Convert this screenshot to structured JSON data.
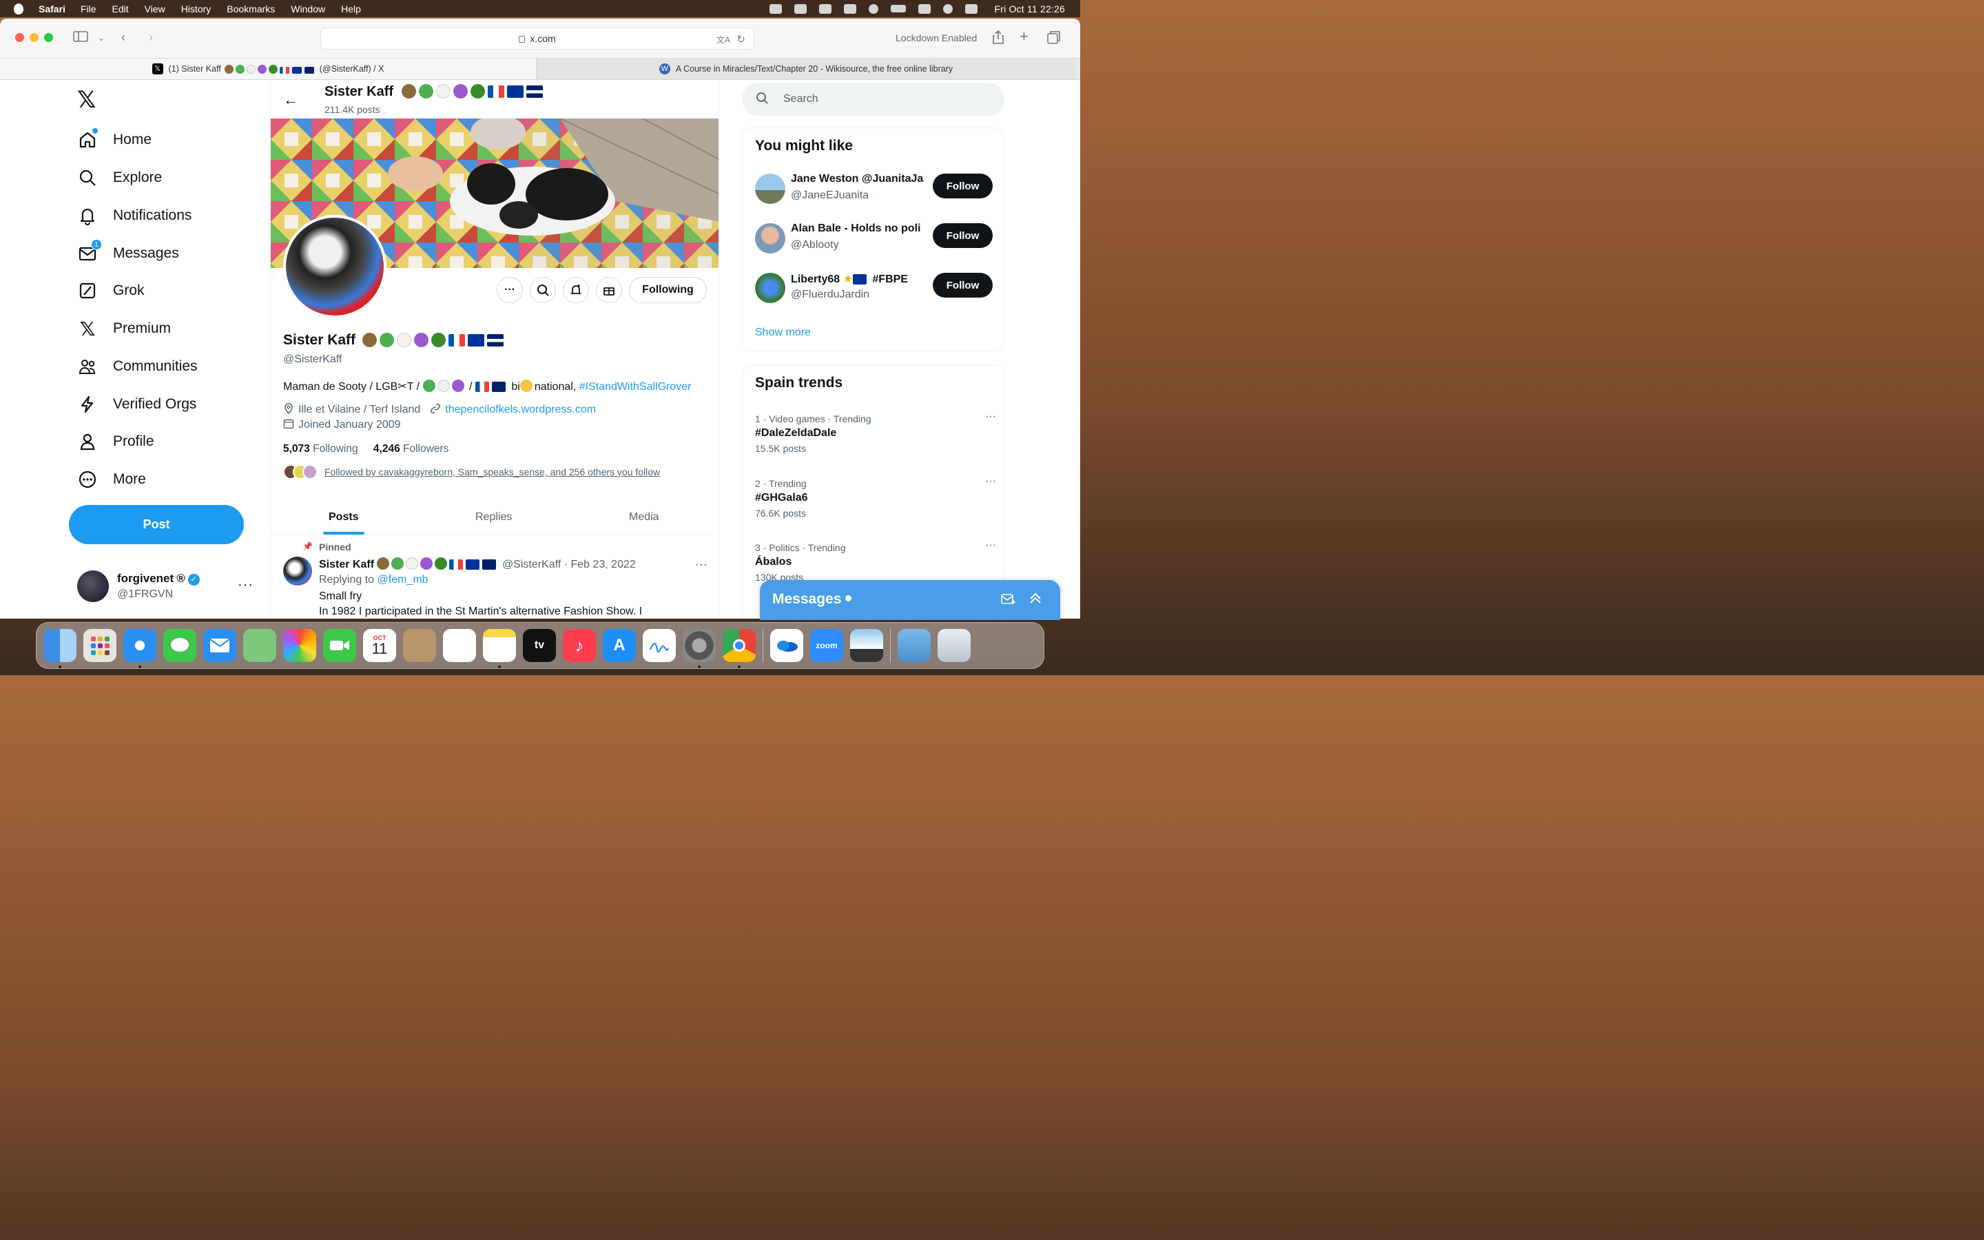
{
  "menubar": {
    "app": "Safari",
    "items": [
      "File",
      "Edit",
      "View",
      "History",
      "Bookmarks",
      "Window",
      "Help"
    ],
    "clock": "Fri Oct 11  22:26"
  },
  "browser": {
    "url": "x.com",
    "lockdown": "Lockdown Enabled",
    "tabs": [
      {
        "title": "(1) Sister Kaff",
        "suffix": "(@SisterKaff) / X"
      },
      {
        "title": "A Course in Miracles/Text/Chapter 20 - Wikisource, the free online library"
      }
    ]
  },
  "nav": {
    "items": [
      {
        "label": "Home",
        "icon": "home-icon"
      },
      {
        "label": "Explore",
        "icon": "search-icon"
      },
      {
        "label": "Notifications",
        "icon": "bell-icon"
      },
      {
        "label": "Messages",
        "icon": "mail-icon",
        "badge": "1"
      },
      {
        "label": "Grok",
        "icon": "grok-icon"
      },
      {
        "label": "Premium",
        "icon": "x-logo-icon"
      },
      {
        "label": "Communities",
        "icon": "people-icon"
      },
      {
        "label": "Verified Orgs",
        "icon": "lightning-icon"
      },
      {
        "label": "Profile",
        "icon": "person-icon"
      },
      {
        "label": "More",
        "icon": "more-circle-icon"
      }
    ],
    "post_label": "Post",
    "account": {
      "name": "forgivenet",
      "symbol": "®",
      "handle": "@1FRGVN"
    }
  },
  "profile": {
    "name": "Sister Kaff",
    "posts_count": "211.4K posts",
    "handle": "@SisterKaff",
    "following_label": "Following",
    "bio_text": "Maman de Sooty / LGB",
    "bio_t": "T /",
    "bio_mid": "/",
    "bio_bi": "bi",
    "bio_national": "national,",
    "bio_hashtag": "#IStandWithSallGrover",
    "location": "Ille et Vilaine / Terf Island",
    "website": "thepencilofkels.wordpress.com",
    "joined": "Joined January 2009",
    "following_count": "5,073",
    "following_text": "Following",
    "followers_count": "4,246",
    "followers_text": "Followers",
    "followed_by": "Followed by cavakaggyreborn, Sam_speaks_sense, and 256 others you follow",
    "tabs": [
      "Posts",
      "Replies",
      "Media"
    ]
  },
  "pinned_tweet": {
    "pinned_label": "Pinned",
    "name": "Sister Kaff",
    "handle_date": "@SisterKaff · Feb 23, 2022",
    "replying_prefix": "Replying to",
    "replying_to": "@fem_mb",
    "line1": "Small fry",
    "line2": "In 1982 I participated in the St Martin's alternative Fashion Show. I"
  },
  "sidebar": {
    "search_placeholder": "Search",
    "wtf_title": "You might like",
    "suggestions": [
      {
        "name": "Jane Weston @JuanitaJa",
        "handle": "@JaneEJuanita",
        "button": "Follow"
      },
      {
        "name": "Alan Bale - Holds no poli",
        "handle": "@Ablooty",
        "button": "Follow"
      },
      {
        "name": "Liberty68",
        "name_tail": "#FBPE",
        "handle": "@FluerduJardin",
        "button": "Follow"
      }
    ],
    "show_more": "Show more",
    "trends_title": "Spain trends",
    "trends": [
      {
        "meta": "1 · Video games · Trending",
        "name": "#DaleZeldaDale",
        "posts": "15.5K posts"
      },
      {
        "meta": "2 · Trending",
        "name": "#GHGala6",
        "posts": "76.6K posts"
      },
      {
        "meta": "3 · Politics · Trending",
        "name": "Ábalos",
        "posts": "130K posts"
      }
    ]
  },
  "messages_drawer": {
    "title": "Messages"
  },
  "dock": {
    "calendar_month": "OCT",
    "calendar_day": "11",
    "appletv": "tv",
    "zoom": "zoom"
  },
  "colors": {
    "accent": "#1d9bf0",
    "text": "#0f1419",
    "muted": "#536471"
  }
}
